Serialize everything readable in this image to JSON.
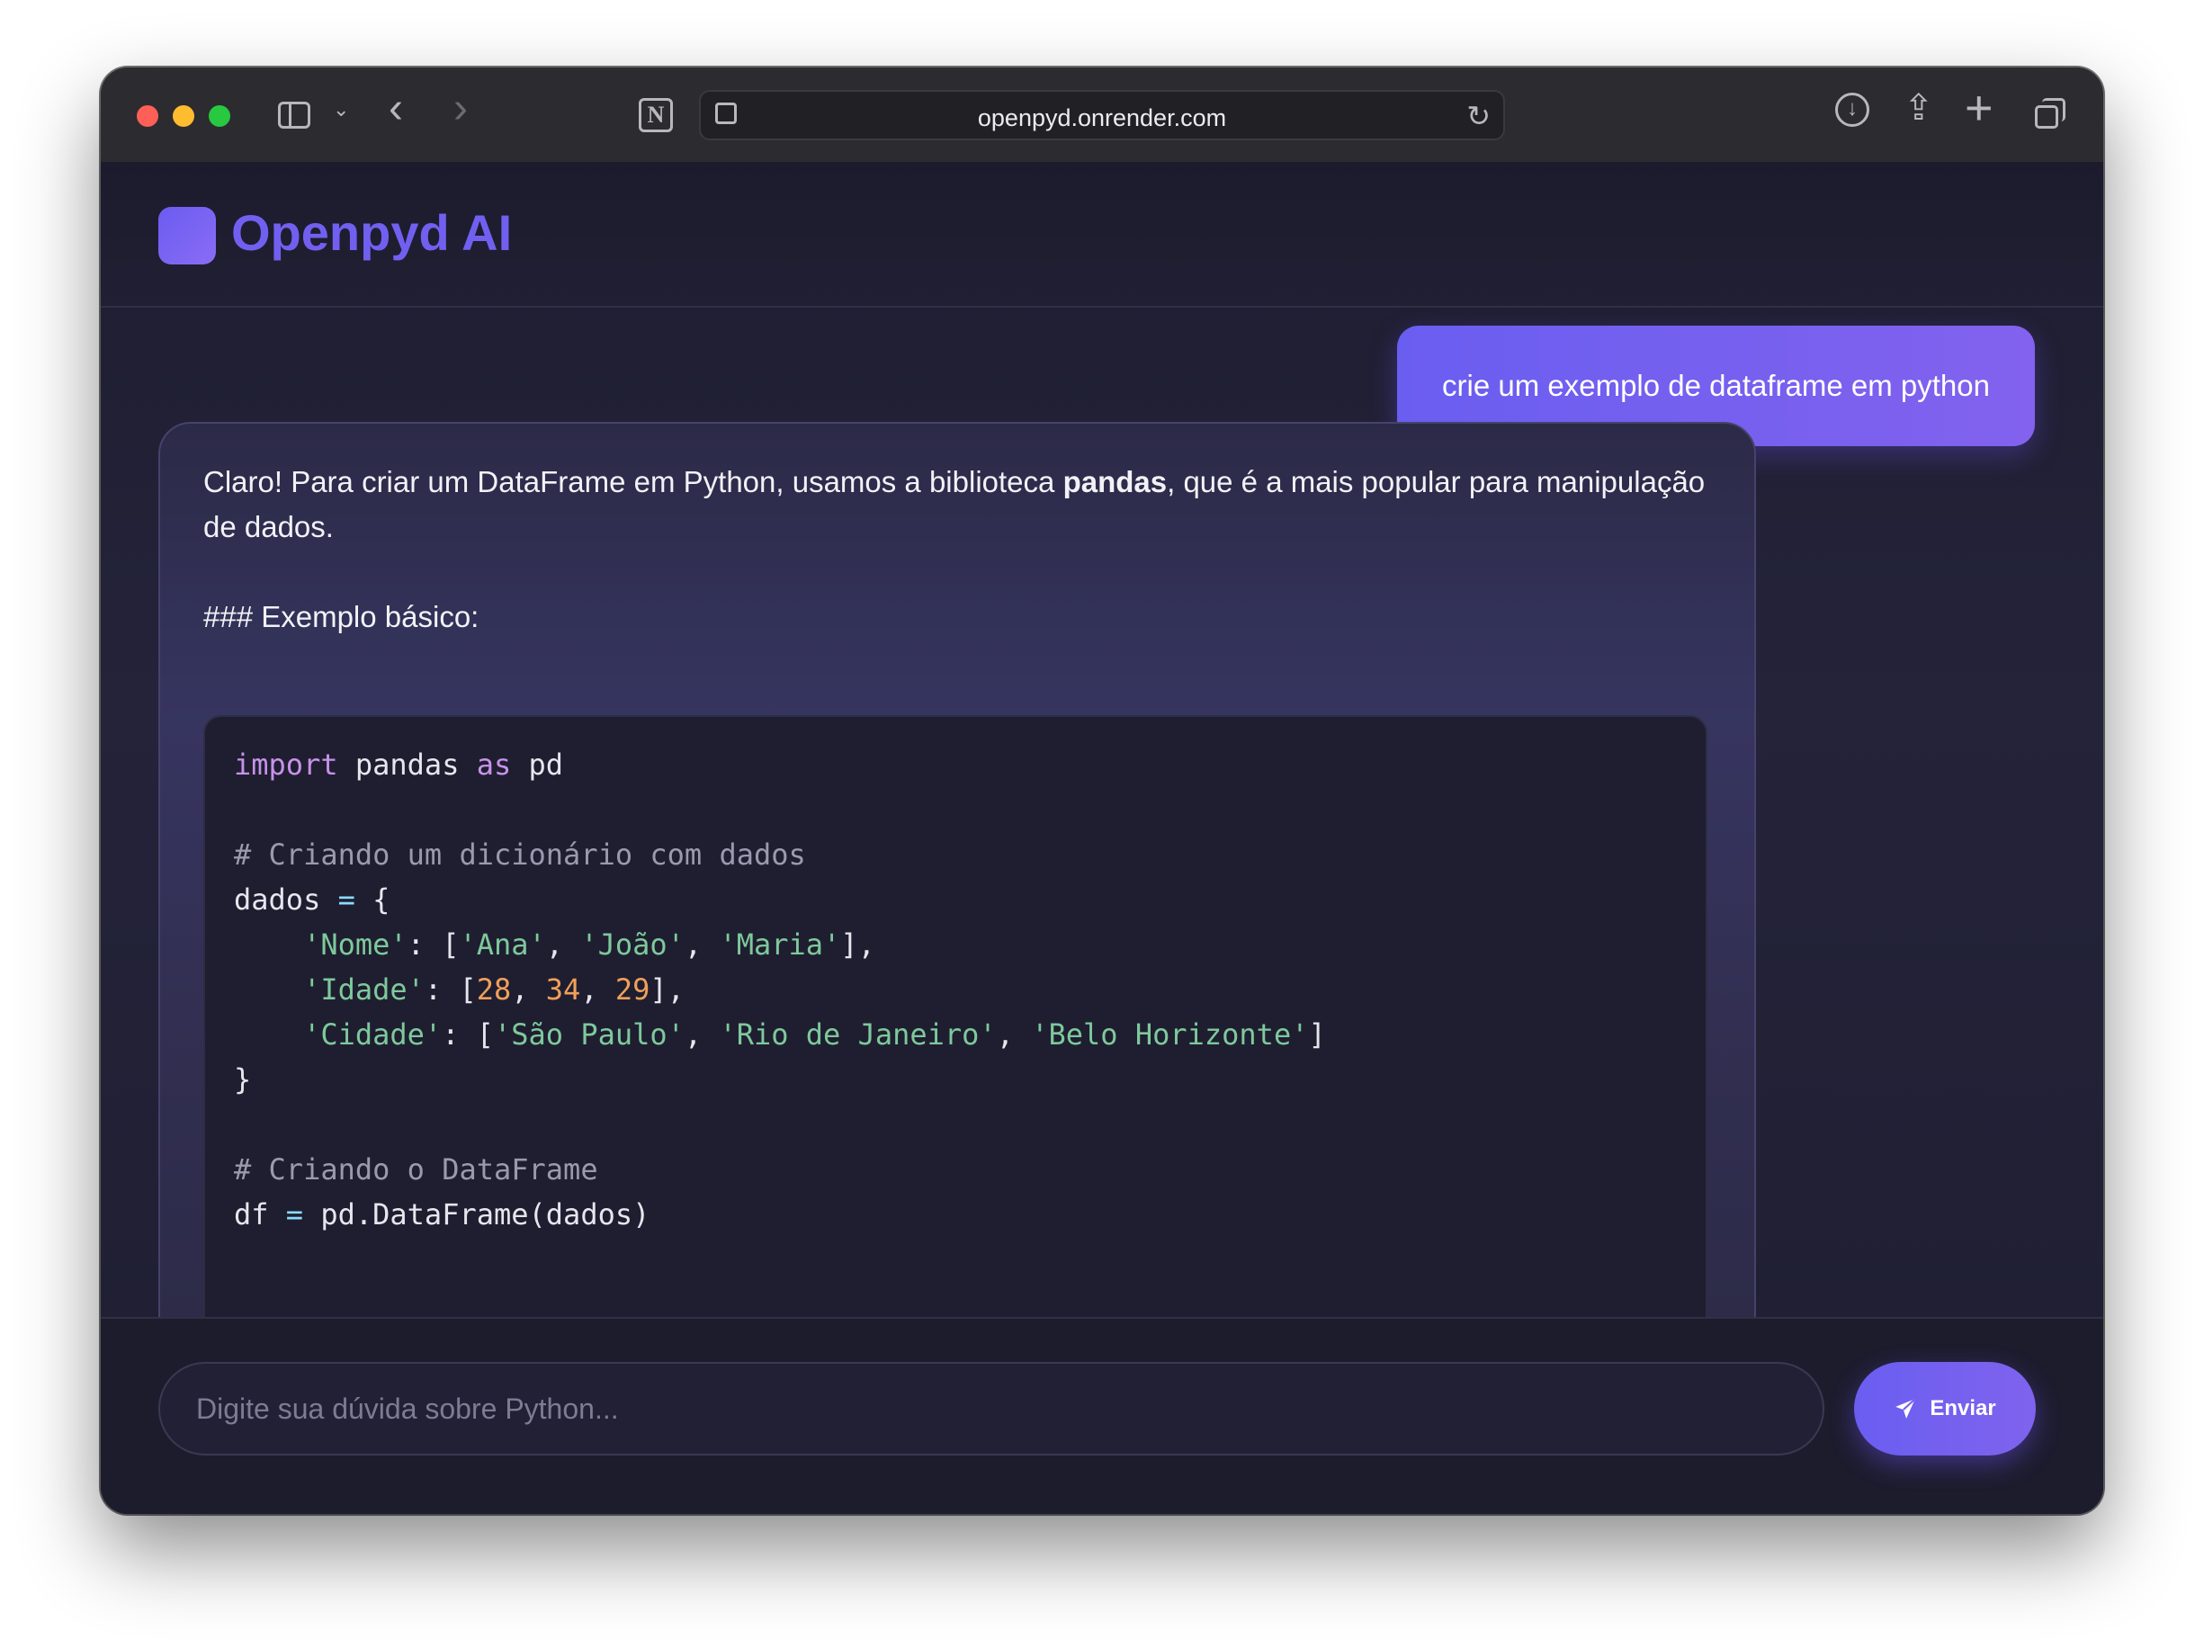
{
  "browser": {
    "url": "openpyd.onrender.com"
  },
  "app": {
    "logo_text": "Openpyd AI"
  },
  "chat": {
    "user_message": "crie um exemplo de dataframe em python",
    "ai_intro_before": "Claro! Para criar um DataFrame em Python, usamos a biblioteca ",
    "ai_intro_bold": "pandas",
    "ai_intro_after": ", que é a mais popular para manipulação de dados.",
    "ai_heading": "### Exemplo básico:",
    "code": {
      "import_kw": "import",
      "import_mod": " pandas ",
      "as_kw": "as",
      "alias": " pd",
      "comment1": "# Criando um dicionário com dados",
      "dados_var": "dados",
      "eq": "=",
      "open_brace": " {",
      "nome_key": "'Nome'",
      "nome_vals": [
        "'Ana'",
        "'João'",
        "'Maria'"
      ],
      "idade_key": "'Idade'",
      "idade_vals": [
        "28",
        "34",
        "29"
      ],
      "cidade_key": "'Cidade'",
      "cidade_vals": [
        "'São Paulo'",
        "'Rio de Janeiro'",
        "'Belo Horizonte'"
      ],
      "close_brace": "}",
      "comment2": "# Criando o DataFrame",
      "df_var": "df",
      "df_call": " pd.DataFrame(dados)"
    }
  },
  "composer": {
    "placeholder": "Digite sua dúvida sobre Python...",
    "send_label": "Enviar"
  },
  "colors": {
    "accent": "#6a5ef0",
    "background": "#1e1d30"
  },
  "icons": [
    "sidebar-icon",
    "chevron-down-icon",
    "back-icon",
    "forward-icon",
    "notion-icon",
    "site-settings-icon",
    "reload-icon",
    "download-icon",
    "share-icon",
    "new-tab-icon",
    "tabs-overview-icon",
    "send-icon"
  ]
}
